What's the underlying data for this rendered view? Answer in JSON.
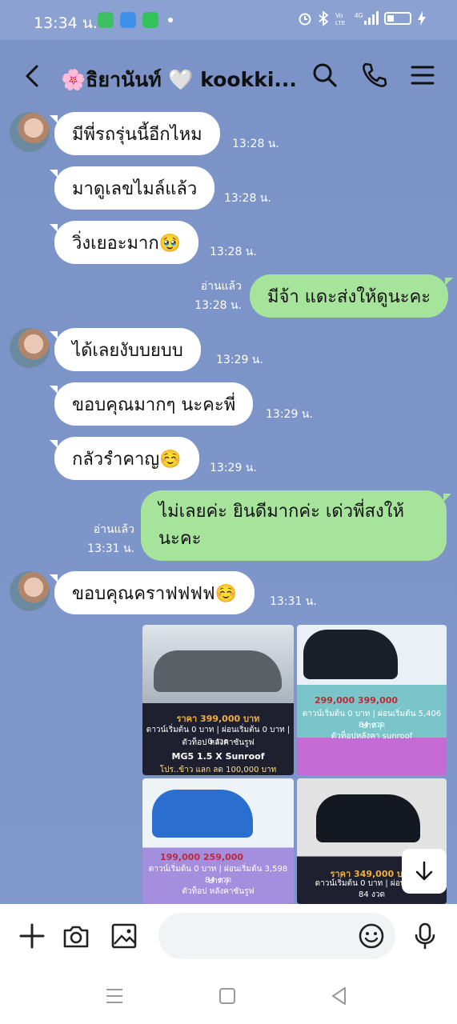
{
  "status": {
    "time": "13:34 น.",
    "network": "4G"
  },
  "header": {
    "title": "🌸ธิยานันท์ 🤍 kookki..."
  },
  "messages": [
    {
      "text": "มีพี่รถรุ่นนี้อีกไหม",
      "time": "13:28 น."
    },
    {
      "text": "มาดูเลขไมล์แล้ว",
      "time": "13:28 น."
    },
    {
      "text": "วิ่งเยอะมาก🥹",
      "time": "13:28 น."
    },
    {
      "text": "มีจ้า แดะส่งให้ดูนะคะ",
      "time": "13:28 น.",
      "read": "อ่านแล้ว"
    },
    {
      "text": "ได้เลยงับบยบบ",
      "time": "13:29 น."
    },
    {
      "text": "ขอบคุณมากๆ นะคะพี่",
      "time": "13:29 น."
    },
    {
      "text": "กลัวรำคาญ☺️",
      "time": "13:29 น."
    },
    {
      "text": "ไม่เลยค่ะ ยินดีมากค่ะ เด่วพี่สงให้",
      "text2": "นะคะ",
      "time": "13:31 น.",
      "read": "อ่านแล้ว"
    },
    {
      "text": "ขอบคุณคราฟฟฟฟ☺️",
      "time": "13:31 น."
    }
  ],
  "photos": [
    {
      "price": "ราคา 399,000 บาท",
      "line1": "ดาวน์เริ่มต้น 0 บาท | ผ่อนเริ่มต้น 0 บาท | 0 งวด",
      "line2": "ตัวท็อป หลังคาซันรูฟ",
      "model": "MG5 1.5 X Sunroof",
      "promo": "โปร..ข้าว แลก ลด 100,000 บาท",
      "car_color": "#5b5f66"
    },
    {
      "price": "299,000  399,000",
      "line1": "ดาวน์เริ่มต้น 0 บาท | ผ่อนเริ่มต้น 5,406 บาท |",
      "line2": "84 งวด",
      "line3": "ตัวท็อปหลังคา sunroof",
      "car_color": "#1b1f28"
    },
    {
      "price": "199,000  259,000",
      "line1": "ดาวน์เริ่มต้น 0 บาท | ผ่อนเริ่มต้น 3,598 บาท |",
      "line2": "84 งวด",
      "line3": "ตัวท็อป หลังคาซันรูฟ",
      "car_color": "#2a6fd0"
    },
    {
      "price": "ราคา 349,000 บาท",
      "line1": "ดาวน์เริ่มต้น 0 บาท | ผ่อนเริ่มต้น",
      "line2": "84 งวด",
      "car_color": "#141820"
    }
  ],
  "colors": {
    "chat_bg": "#7b93c7",
    "incoming": "#ffffff",
    "outgoing": "#a6e39b"
  }
}
